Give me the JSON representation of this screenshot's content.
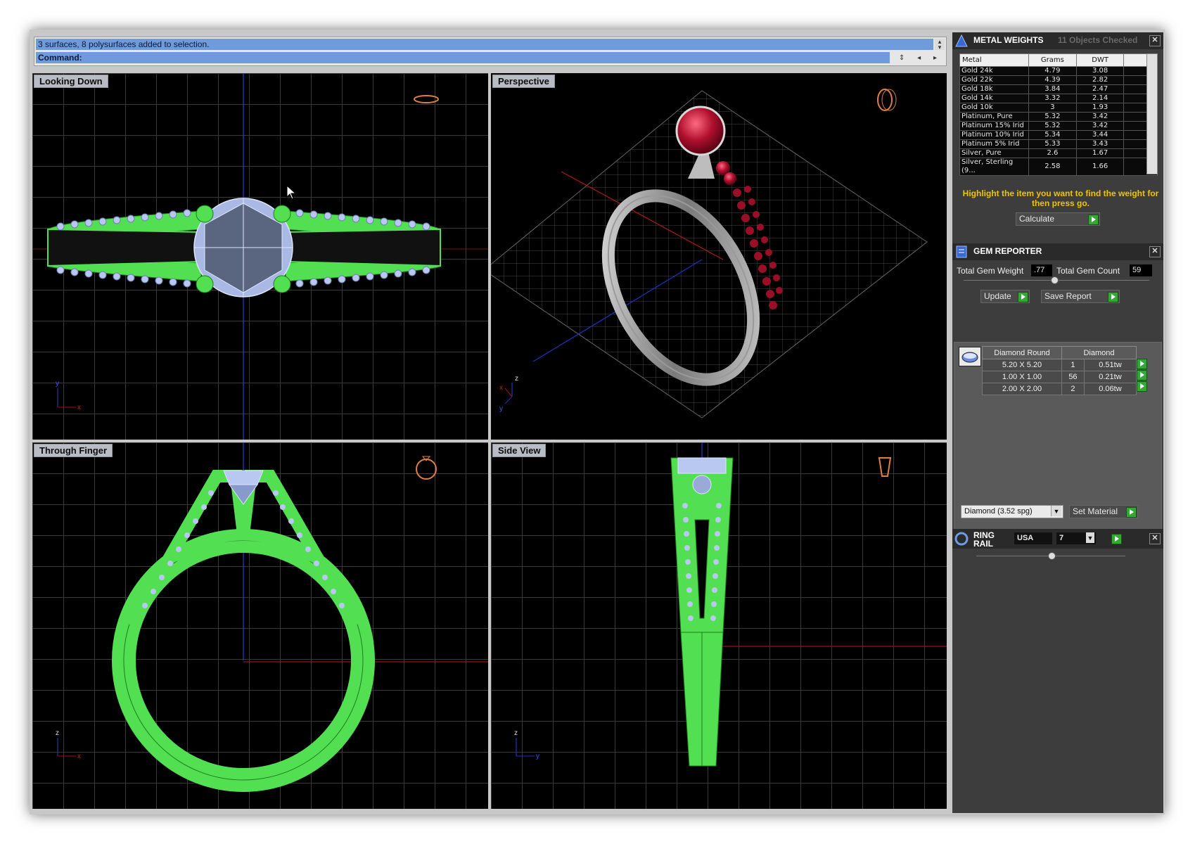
{
  "command_area": {
    "history": "3 surfaces, 8 polysurfaces added to selection.",
    "prompt_label": "Command:"
  },
  "viewports": {
    "top": {
      "title": "Looking Down",
      "axis_a": "y",
      "axis_b": "x"
    },
    "perspective": {
      "title": "Perspective",
      "axis_a": "z",
      "axis_b": "x",
      "axis_c": "y"
    },
    "front": {
      "title": "Through Finger",
      "axis_a": "z",
      "axis_b": "x"
    },
    "side": {
      "title": "Side View",
      "axis_a": "z",
      "axis_b": "y"
    }
  },
  "metal_weights": {
    "title": "METAL WEIGHTS",
    "status": "11 Objects Checked",
    "columns": [
      "Metal",
      "Grams",
      "DWT"
    ],
    "rows": [
      [
        "Gold 24k",
        "4.79",
        "3.08"
      ],
      [
        "Gold 22k",
        "4.39",
        "2.82"
      ],
      [
        "Gold 18k",
        "3.84",
        "2.47"
      ],
      [
        "Gold 14k",
        "3.32",
        "2.14"
      ],
      [
        "Gold 10k",
        "3",
        "1.93"
      ],
      [
        "Platinum, Pure",
        "5.32",
        "3.42"
      ],
      [
        "Platinum 15% Irid",
        "5.32",
        "3.42"
      ],
      [
        "Platinum 10% Irid",
        "5.34",
        "3.44"
      ],
      [
        "Platinum 5% Irid",
        "5.33",
        "3.43"
      ],
      [
        "Silver, Pure",
        "2.6",
        "1.67"
      ],
      [
        "Silver, Sterling (9...",
        "2.58",
        "1.66"
      ]
    ],
    "hint": "Highlight the item you want to find the weight for then press go.",
    "calculate_label": "Calculate"
  },
  "gem_reporter": {
    "title": "GEM REPORTER",
    "total_weight_label": "Total Gem Weight",
    "total_weight_value": ".77",
    "total_count_label": "Total Gem Count",
    "total_count_value": "59",
    "update_label": "Update",
    "save_report_label": "Save Report",
    "columns": [
      "Diamond Round",
      "Diamond"
    ],
    "rows": [
      [
        "5.20 X 5.20",
        "1",
        "0.51tw"
      ],
      [
        "1.00 X 1.00",
        "56",
        "0.21tw"
      ],
      [
        "2.00 X 2.00",
        "2",
        "0.06tw"
      ]
    ],
    "material_value": "Diamond    (3.52 spg)",
    "set_material_label": "Set Material"
  },
  "ring_rail": {
    "title": "RING RAIL",
    "region": "USA",
    "size": "7"
  },
  "colors": {
    "wire_green": "#52e052",
    "wire_blue": "#b8c8f0",
    "ruby": "#a0102a",
    "accent_yellow": "#f2c400"
  }
}
